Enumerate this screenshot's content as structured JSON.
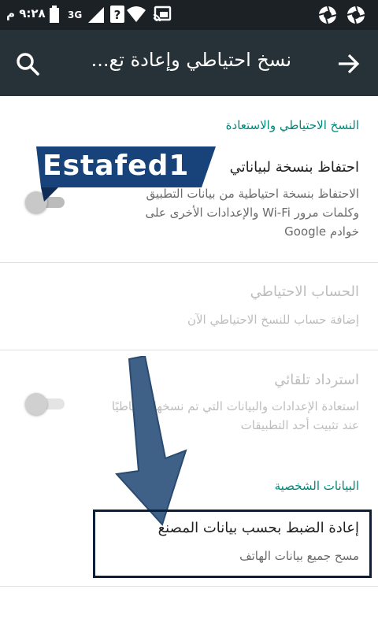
{
  "status_bar": {
    "time": "٩:٢٨ م",
    "network": "3G",
    "icons": [
      "battery-icon",
      "signal-icon",
      "notification-icon",
      "wifi-icon",
      "cast-icon",
      "aperture-icon",
      "aperture-icon"
    ]
  },
  "app_bar": {
    "title": "نسخ احتياطي وإعادة تع...",
    "back_icon": "arrow-forward-icon",
    "search_icon": "search-icon"
  },
  "sections": {
    "backup_header": "النسخ الاحتياطي والاستعادة",
    "backup_data": {
      "title": "احتفاظ بنسخة لبياناتي",
      "summary": "الاحتفاظ بنسخة احتياطية من بيانات التطبيق وكلمات مرور Wi-Fi والإعدادات الأخرى على خوادم Google",
      "switch_on": false
    },
    "backup_account": {
      "title": "الحساب الاحتياطي",
      "summary": "إضافة حساب للنسخ الاحتياطي الآن"
    },
    "auto_restore": {
      "title": "استرداد تلقائي",
      "summary": "استعادة الإعدادات والبيانات التي تم نسخها احتياطيًا عند تثبيت أحد التطبيقات",
      "switch_on": false
    },
    "personal_header": "البيانات الشخصية",
    "factory_reset": {
      "title": "إعادة الضبط بحسب بيانات المصنع",
      "summary": "مسح جميع بيانات الهاتف"
    }
  },
  "overlay": {
    "watermark": "Estafed1",
    "watermark_color": "#17427a",
    "highlight_color": "#0b1e3a",
    "arrow_color": "#3f6188"
  }
}
